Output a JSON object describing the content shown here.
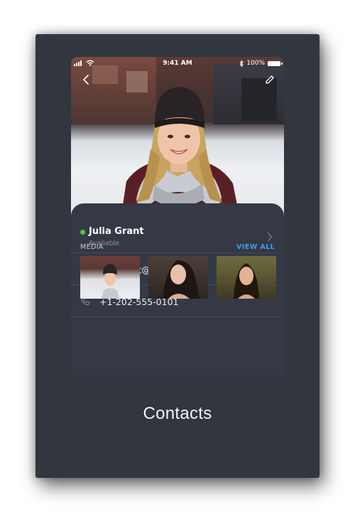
{
  "status_bar": {
    "time": "9:41 AM",
    "battery": "100%"
  },
  "contact": {
    "name": "Julia Grant",
    "presence": "Available",
    "email": "juliagrant@mail.com",
    "phone": "+1-202-555-0101"
  },
  "media": {
    "label": "MEDIA",
    "view_all": "VIEW ALL"
  },
  "page_title": "Contacts",
  "colors": {
    "background": "#31363f",
    "sheet": "#343945",
    "online": "#5cc33a",
    "accent": "#3aa0e8"
  },
  "icons": [
    "back-icon",
    "edit-icon",
    "signal-icon",
    "wifi-icon",
    "bluetooth-icon",
    "battery-icon",
    "chevron-right-icon",
    "mail-icon",
    "phone-icon"
  ]
}
